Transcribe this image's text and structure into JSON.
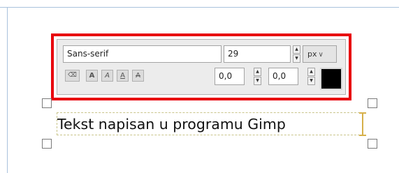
{
  "toolbar": {
    "font_name": "Sans-serif",
    "font_size": "29",
    "unit": "px",
    "indent": "0,0",
    "line_spacing": "0,0",
    "color": "#000000",
    "highlight_color": "#e8000b"
  },
  "icons": {
    "clear": "clear-style-icon",
    "bold": "A",
    "italic": "A",
    "underline": "A",
    "strikethrough": "A",
    "spin_up": "▲",
    "spin_down": "▼",
    "chevron": "chevron-down-icon"
  },
  "canvas": {
    "text": "Tekst napisan u programu Gimp"
  }
}
